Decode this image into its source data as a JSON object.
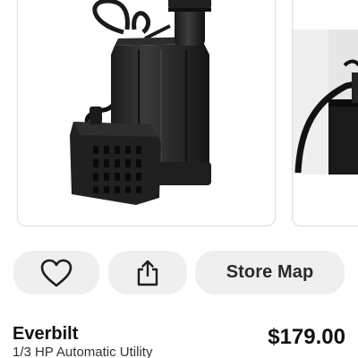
{
  "carousel": {
    "images": [
      {
        "subject": "submersible-utility-pump"
      },
      {
        "subject": "pump-partial-view"
      }
    ]
  },
  "actions": {
    "favorite_icon": "heart-icon",
    "share_icon": "share-icon",
    "store_map_label": "Store Map"
  },
  "product": {
    "brand": "Everbilt",
    "description": "1/3 HP Automatic Utility",
    "price": "$179.00"
  },
  "colors": {
    "button_bg": "#efefef",
    "text_primary": "#111111",
    "card_border": "#dcdcdc",
    "pump_body": "#262626"
  }
}
